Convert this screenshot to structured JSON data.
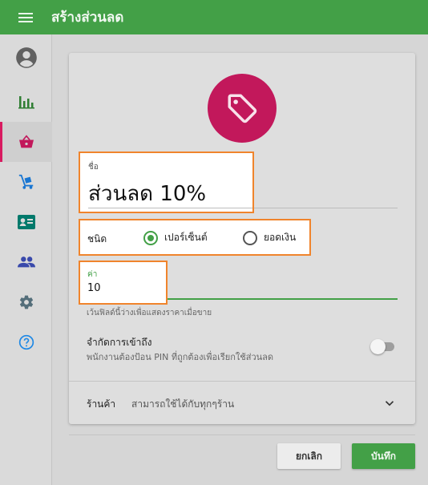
{
  "appbar": {
    "title": "สร้างส่วนลด",
    "menu_icon": "hamburger-icon"
  },
  "sidebar": {
    "items": [
      {
        "name": "account",
        "icon": "account-circle-icon",
        "active": false
      },
      {
        "name": "reports",
        "icon": "bar-chart-icon",
        "active": false
      },
      {
        "name": "items",
        "icon": "basket-icon",
        "active": true
      },
      {
        "name": "inventory",
        "icon": "dolly-icon",
        "active": false
      },
      {
        "name": "customers",
        "icon": "id-card-icon",
        "active": false
      },
      {
        "name": "employees",
        "icon": "people-icon",
        "active": false
      },
      {
        "name": "settings",
        "icon": "gear-icon",
        "active": false
      },
      {
        "name": "help",
        "icon": "help-circle-icon",
        "active": false
      }
    ]
  },
  "form": {
    "badge_icon": "tag-icon",
    "name_label": "ชื่อ",
    "name_value": "ส่วนลด 10%",
    "type_label": "ชนิด",
    "type_options": [
      {
        "label": "เปอร์เซ็นต์",
        "checked": true
      },
      {
        "label": "ยอดเงิน",
        "checked": false
      }
    ],
    "value_label": "ค่า",
    "value_value": "10",
    "value_hint": "เว้นฟิลด์นี้ว่างเพื่อแสดงราคาเมื่อขาย",
    "restrict_title": "จำกัดการเข้าถึง",
    "restrict_desc": "พนักงานต้องป้อน PIN ที่ถูกต้องเพื่อเรียกใช้ส่วนลด",
    "restrict_enabled": false,
    "store_label": "ร้านค้า",
    "store_value": "สามารถใช้ได้กับทุกๆร้าน"
  },
  "actions": {
    "cancel_label": "ยกเลิก",
    "save_label": "บันทึก"
  },
  "colors": {
    "primary": "#43a047",
    "accent": "#d81b60",
    "highlight": "#f0842c"
  }
}
